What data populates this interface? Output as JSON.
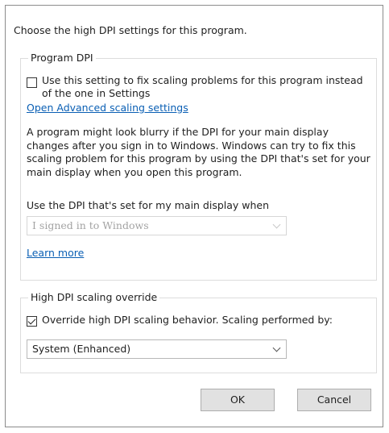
{
  "dialog": {
    "intro": "Choose the high DPI settings for this program."
  },
  "program_dpi": {
    "legend": "Program DPI",
    "checkbox_label": "Use this setting to fix scaling problems for this program instead of the one in Settings",
    "checked": false,
    "advanced_link": "Open Advanced scaling settings",
    "description": "A program might look blurry if the DPI for your main display changes after you sign in to Windows. Windows can try to fix this scaling problem for this program by using the DPI that's set for your main display when you open this program.",
    "select_label": "Use the DPI that's set for my main display when",
    "select_value": "I signed in to Windows",
    "learn_more": "Learn more"
  },
  "override": {
    "legend": "High DPI scaling override",
    "checkbox_label": "Override high DPI scaling behavior. Scaling performed by:",
    "checked": true,
    "select_value": "System (Enhanced)"
  },
  "buttons": {
    "ok": "OK",
    "cancel": "Cancel"
  },
  "icons": {
    "dropdown": "chevron-down-icon"
  }
}
